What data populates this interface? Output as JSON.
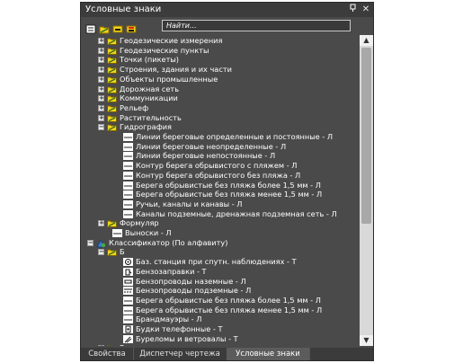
{
  "window": {
    "title": "Условные знаки",
    "pin_icon": "pin-icon",
    "close_icon": "close-icon"
  },
  "toolbar": {
    "icons": [
      "new-icon",
      "folder-icon",
      "minus-icon",
      "flag-icon"
    ],
    "search_placeholder": "Найти..."
  },
  "tree": [
    {
      "level": 1,
      "expander": "+",
      "icon": "folder",
      "label": "Геодезические измерения"
    },
    {
      "level": 1,
      "expander": "+",
      "icon": "folder",
      "label": "Геодезические пункты"
    },
    {
      "level": 1,
      "expander": "+",
      "icon": "folder",
      "label": "Точки (пикеты)"
    },
    {
      "level": 1,
      "expander": "+",
      "icon": "folder",
      "label": "Строения, здания и их части"
    },
    {
      "level": 1,
      "expander": "+",
      "icon": "folder",
      "label": "Объекты промышленные"
    },
    {
      "level": 1,
      "expander": "+",
      "icon": "folder",
      "label": "Дорожная сеть"
    },
    {
      "level": 1,
      "expander": "+",
      "icon": "folder",
      "label": "Коммуникации"
    },
    {
      "level": 1,
      "expander": "+",
      "icon": "folder",
      "label": "Рельеф"
    },
    {
      "level": 1,
      "expander": "+",
      "icon": "folder",
      "label": "Растительность"
    },
    {
      "level": 1,
      "expander": "−",
      "icon": "folder",
      "label": "Гидрография"
    },
    {
      "level": 2,
      "expander": "",
      "icon": "line",
      "label": "Линии береговые определенные и постоянные - Л"
    },
    {
      "level": 2,
      "expander": "",
      "icon": "line",
      "label": "Линии береговые неопределенные - Л"
    },
    {
      "level": 2,
      "expander": "",
      "icon": "line",
      "label": "Линии береговые непостоянные - Л"
    },
    {
      "level": 2,
      "expander": "",
      "icon": "line",
      "label": "Контур берега обрывистого с пляжем - Л"
    },
    {
      "level": 2,
      "expander": "",
      "icon": "line",
      "label": "Контур берега обрывистого без пляжа - Л"
    },
    {
      "level": 2,
      "expander": "",
      "icon": "line",
      "label": "Берега обрывистые без пляжа более 1,5 мм - Л"
    },
    {
      "level": 2,
      "expander": "",
      "icon": "line",
      "label": "Берега обрывистые без пляжа менее 1,5 мм - Л"
    },
    {
      "level": 2,
      "expander": "",
      "icon": "line",
      "label": "Ручьи, каналы и канавы - Л"
    },
    {
      "level": 2,
      "expander": "",
      "icon": "line",
      "label": "Каналы подземные, дренажная подземная сеть - Л"
    },
    {
      "level": 1,
      "expander": "+",
      "icon": "folder",
      "label": "Формуляр"
    },
    {
      "level": 1,
      "expander": "",
      "icon": "line",
      "label": "Выноски - Л"
    },
    {
      "level": 0,
      "expander": "−",
      "icon": "classifier",
      "label": "Классификатор (По алфавиту)"
    },
    {
      "level": 1,
      "expander": "−",
      "icon": "folder",
      "label": "Б"
    },
    {
      "level": 2,
      "expander": "",
      "icon": "station",
      "label": "Баз. станция при спутн. наблюдениях - Т"
    },
    {
      "level": 2,
      "expander": "",
      "icon": "fuel",
      "label": "Бензозаправки - Т"
    },
    {
      "level": 2,
      "expander": "",
      "icon": "pipe",
      "label": "Бензопроводы наземные - Л"
    },
    {
      "level": 2,
      "expander": "",
      "icon": "pipe2",
      "label": "Бензопроводы подземные - Л"
    },
    {
      "level": 2,
      "expander": "",
      "icon": "line",
      "label": "Берега обрывистые без пляжа более 1,5 мм - Л"
    },
    {
      "level": 2,
      "expander": "",
      "icon": "line",
      "label": "Берега обрывистые без пляжа менее 1,5 мм - Л"
    },
    {
      "level": 2,
      "expander": "",
      "icon": "line",
      "label": "Брандмауэры - Л"
    },
    {
      "level": 2,
      "expander": "",
      "icon": "phone",
      "label": "Будки телефонные - Т"
    },
    {
      "level": 2,
      "expander": "",
      "icon": "wind",
      "label": "Буреломы и ветровалы - Т"
    },
    {
      "level": 1,
      "expander": "+",
      "icon": "folder",
      "label": "В"
    }
  ],
  "tabs": [
    {
      "label": "Свойства",
      "active": false
    },
    {
      "label": "Диспетчер чертежа",
      "active": false
    },
    {
      "label": "Условные знаки",
      "active": true
    }
  ],
  "colors": {
    "panel": "#4a4a4a",
    "text": "#ffffff",
    "folder": "#f2d31b",
    "scrollbar": "#d9d9d9"
  }
}
